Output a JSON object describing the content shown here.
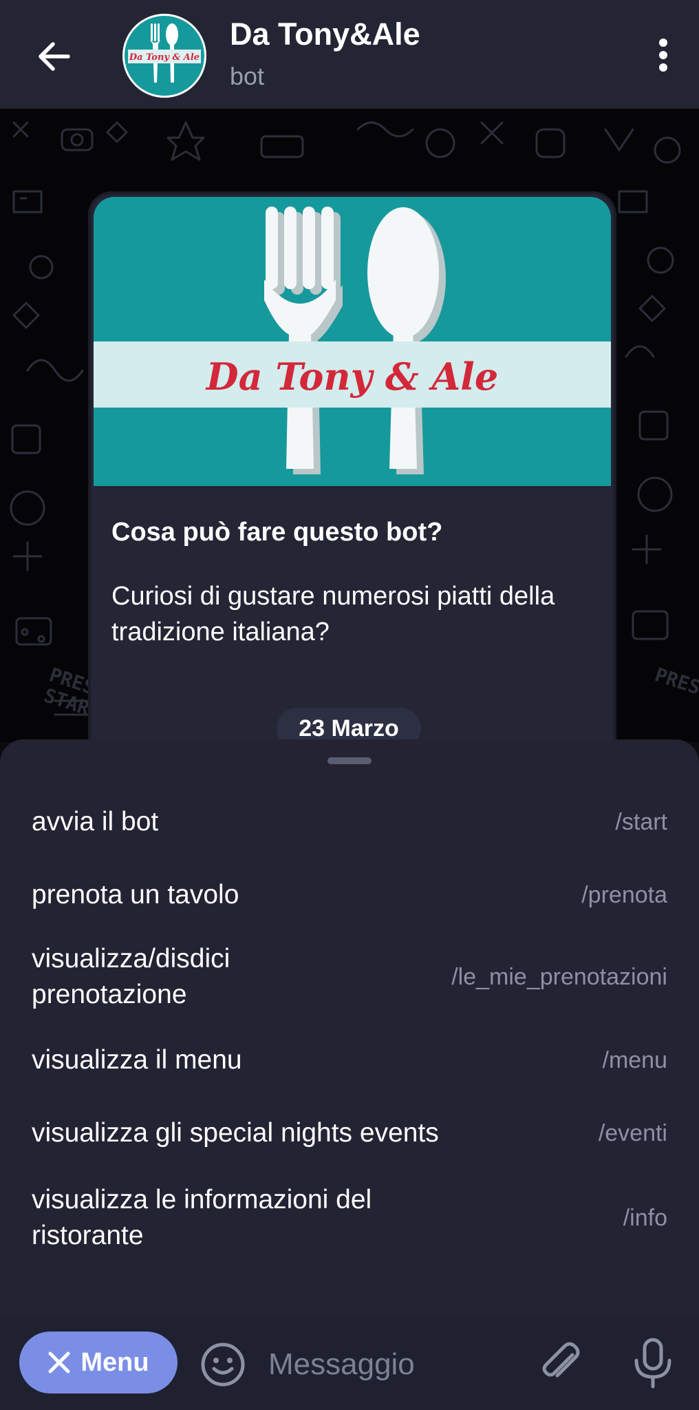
{
  "header": {
    "back_icon": "arrow-left-icon",
    "title": "Da Tony&Ale",
    "subtitle": "bot",
    "logo_text": "Da Tony & Ale",
    "more_icon": "more-vertical-icon"
  },
  "bot_info": {
    "cover_text": "Da Tony & Ale",
    "heading": "Cosa può fare questo bot?",
    "description": "Curiosi di gustare numerosi piatti della tradizione italiana?"
  },
  "date_separator": "23 Marzo",
  "commands": [
    {
      "label": "avvia il bot",
      "command": "/start"
    },
    {
      "label": "prenota un tavolo",
      "command": "/prenota"
    },
    {
      "label": "visualizza/disdici prenotazione",
      "command": "/le_mie_prenotazioni"
    },
    {
      "label": "visualizza il menu",
      "command": "/menu"
    },
    {
      "label": "visualizza gli special nights events",
      "command": "/eventi"
    },
    {
      "label": "visualizza le informazioni del ristorante",
      "command": "/info"
    }
  ],
  "input_bar": {
    "menu_label": "Menu",
    "placeholder": "Messaggio",
    "icons": [
      "close-icon",
      "emoji-icon",
      "paperclip-icon",
      "microphone-icon"
    ]
  },
  "colors": {
    "header_bg": "#232534",
    "sheet_bg": "#232334",
    "accent": "#7b8ee6",
    "cover_teal": "#16999c",
    "logo_red": "#d3283a"
  }
}
